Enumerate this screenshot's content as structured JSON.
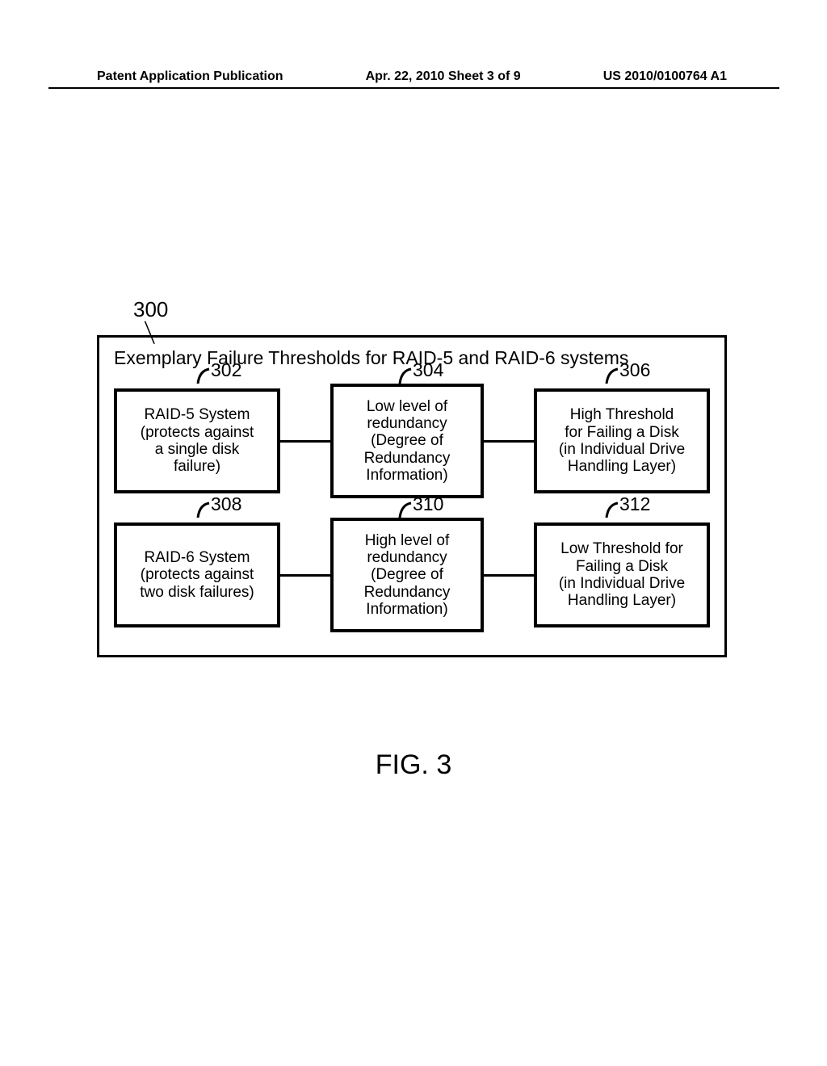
{
  "header": {
    "left": "Patent Application Publication",
    "center": "Apr. 22, 2010  Sheet 3 of 9",
    "right": "US 2010/0100764 A1"
  },
  "diagram": {
    "ref": "300",
    "title": "Exemplary Failure Thresholds for RAID-5 and RAID-6 systems",
    "rows": [
      {
        "cells": [
          {
            "num": "302",
            "text": "RAID-5 System\n(protects against\na single disk\nfailure)"
          },
          {
            "num": "304",
            "text": "Low level of\nredundancy\n(Degree of\nRedundancy\nInformation)"
          },
          {
            "num": "306",
            "text": "High Threshold\nfor Failing a Disk\n(in Individual Drive\nHandling Layer)"
          }
        ]
      },
      {
        "cells": [
          {
            "num": "308",
            "text": "RAID-6 System\n(protects against\ntwo disk failures)"
          },
          {
            "num": "310",
            "text": "High level of\nredundancy\n(Degree of\nRedundancy\nInformation)"
          },
          {
            "num": "312",
            "text": "Low Threshold for\nFailing a Disk\n(in Individual Drive\nHandling Layer)"
          }
        ]
      }
    ]
  },
  "figure_label": "FIG. 3"
}
